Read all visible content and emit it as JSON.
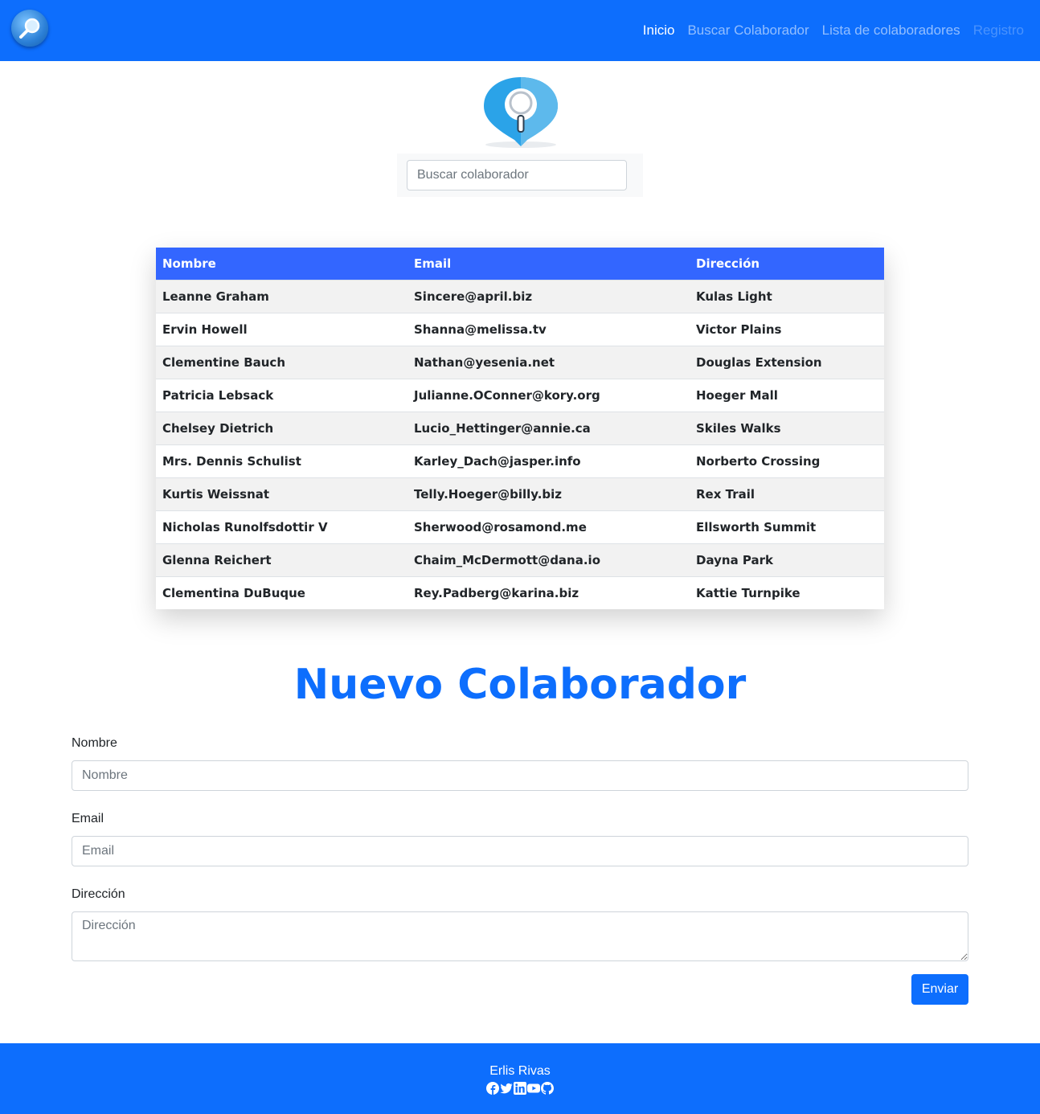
{
  "navbar": {
    "brand_icon": "magnifier-icon",
    "links": [
      {
        "label": "Inicio",
        "state": "active"
      },
      {
        "label": "Buscar Colaborador",
        "state": "normal"
      },
      {
        "label": "Lista de colaboradores",
        "state": "normal"
      },
      {
        "label": "Registro",
        "state": "disabled"
      }
    ]
  },
  "search": {
    "logo_icon": "map-pin-search-icon",
    "placeholder": "Buscar colaborador",
    "value": ""
  },
  "table": {
    "headers": [
      "Nombre",
      "Email",
      "Dirección"
    ],
    "rows": [
      [
        "Leanne Graham",
        "Sincere@april.biz",
        "Kulas Light"
      ],
      [
        "Ervin Howell",
        "Shanna@melissa.tv",
        "Victor Plains"
      ],
      [
        "Clementine Bauch",
        "Nathan@yesenia.net",
        "Douglas Extension"
      ],
      [
        "Patricia Lebsack",
        "Julianne.OConner@kory.org",
        "Hoeger Mall"
      ],
      [
        "Chelsey Dietrich",
        "Lucio_Hettinger@annie.ca",
        "Skiles Walks"
      ],
      [
        "Mrs. Dennis Schulist",
        "Karley_Dach@jasper.info",
        "Norberto Crossing"
      ],
      [
        "Kurtis Weissnat",
        "Telly.Hoeger@billy.biz",
        "Rex Trail"
      ],
      [
        "Nicholas Runolfsdottir V",
        "Sherwood@rosamond.me",
        "Ellsworth Summit"
      ],
      [
        "Glenna Reichert",
        "Chaim_McDermott@dana.io",
        "Dayna Park"
      ],
      [
        "Clementina DuBuque",
        "Rey.Padberg@karina.biz",
        "Kattie Turnpike"
      ]
    ]
  },
  "form": {
    "title": "Nuevo Colaborador",
    "nombre": {
      "label": "Nombre",
      "placeholder": "Nombre",
      "value": ""
    },
    "email": {
      "label": "Email",
      "placeholder": "Email",
      "value": ""
    },
    "direccion": {
      "label": "Dirección",
      "placeholder": "Dirección",
      "value": ""
    },
    "submit_label": "Enviar"
  },
  "footer": {
    "name": "Erlis Rivas",
    "socials": [
      "facebook-icon",
      "twitter-icon",
      "linkedin-icon",
      "youtube-icon",
      "github-icon"
    ]
  },
  "colors": {
    "primary": "#0d6efd",
    "table_header": "#3366ff",
    "row_stripe": "#f2f2f2"
  }
}
